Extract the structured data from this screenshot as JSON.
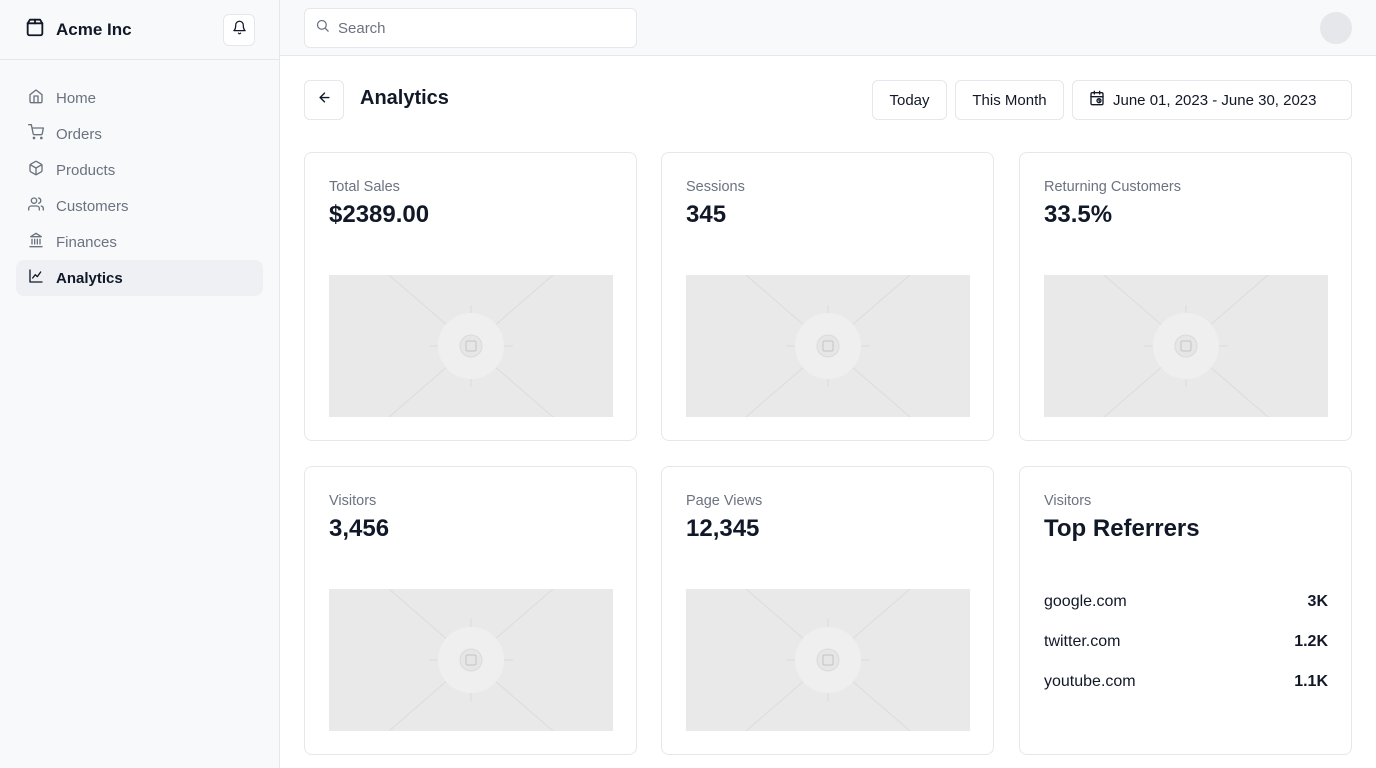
{
  "app": {
    "brand_name": "Acme Inc",
    "brand_icon": "package-icon",
    "bell_icon": "bell-icon"
  },
  "sidebar": {
    "items": [
      {
        "label": "Home",
        "icon": "home-icon",
        "active": false
      },
      {
        "label": "Orders",
        "icon": "cart-icon",
        "active": false
      },
      {
        "label": "Products",
        "icon": "box-icon",
        "active": false
      },
      {
        "label": "Customers",
        "icon": "users-icon",
        "active": false
      },
      {
        "label": "Finances",
        "icon": "bank-icon",
        "active": false
      },
      {
        "label": "Analytics",
        "icon": "line-chart-icon",
        "active": true
      }
    ]
  },
  "topbar": {
    "search_placeholder": "Search",
    "search_value": ""
  },
  "header": {
    "title": "Analytics",
    "today_label": "Today",
    "month_label": "This Month",
    "date_range": "June 01, 2023 - June 30, 2023"
  },
  "cards": [
    {
      "label": "Total Sales",
      "value": "$2389.00"
    },
    {
      "label": "Sessions",
      "value": "345"
    },
    {
      "label": "Returning Customers",
      "value": "33.5%"
    },
    {
      "label": "Visitors",
      "value": "3,456"
    },
    {
      "label": "Page Views",
      "value": "12,345"
    }
  ],
  "referrers": {
    "label": "Visitors",
    "title": "Top Referrers",
    "rows": [
      {
        "site": "google.com",
        "count": "3K"
      },
      {
        "site": "twitter.com",
        "count": "1.2K"
      },
      {
        "site": "youtube.com",
        "count": "1.1K"
      }
    ]
  },
  "colors": {
    "sidebar_bg": "#f8f9fa",
    "active_bg": "#eef0f3",
    "border": "#e5e7eb",
    "muted_text": "#6b7280",
    "placeholder_bg": "#e9e9e9"
  }
}
